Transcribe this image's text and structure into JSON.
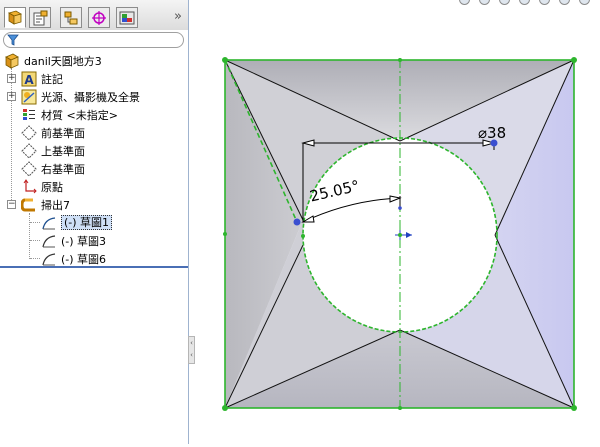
{
  "feature_tree": {
    "tabs": [
      "feature-manager",
      "property-manager",
      "configuration-manager",
      "dim-xpert-manager",
      "display-manager"
    ],
    "more_symbol": "»",
    "filter_icon": "funnel-icon",
    "root": {
      "label": "danil天圓地方3",
      "icon": "part-icon"
    },
    "items": [
      {
        "label": "註記",
        "icon": "annotations-icon",
        "expandable": true
      },
      {
        "label": "光源、攝影機及全景",
        "icon": "lights-icon",
        "expandable": true
      },
      {
        "label": "材質 <未指定>",
        "icon": "material-icon",
        "expandable": false
      },
      {
        "label": "前基準面",
        "icon": "plane-icon",
        "expandable": false
      },
      {
        "label": "上基準面",
        "icon": "plane-icon",
        "expandable": false
      },
      {
        "label": "右基準面",
        "icon": "plane-icon",
        "expandable": false
      },
      {
        "label": "原點",
        "icon": "origin-icon",
        "expandable": false
      },
      {
        "label": "掃出7",
        "icon": "sweep-icon",
        "expandable": true,
        "expanded": true
      }
    ],
    "sub_items": [
      {
        "label": "(-) 草圖1",
        "icon": "sketch-icon",
        "selected": true
      },
      {
        "label": "(-) 草圖3",
        "icon": "sketch-icon",
        "selected": false
      },
      {
        "label": "(-) 草圖6",
        "icon": "sketch-icon",
        "selected": false
      }
    ]
  },
  "graphics": {
    "dim_diameter": "⌀38",
    "dim_angle": "25.05°",
    "colors": {
      "sketch_green": "#2db52d",
      "face_gray": "#c7c7cc",
      "face_purple": "#d2d2f2",
      "dim_blue": "#3a4fd0"
    }
  }
}
